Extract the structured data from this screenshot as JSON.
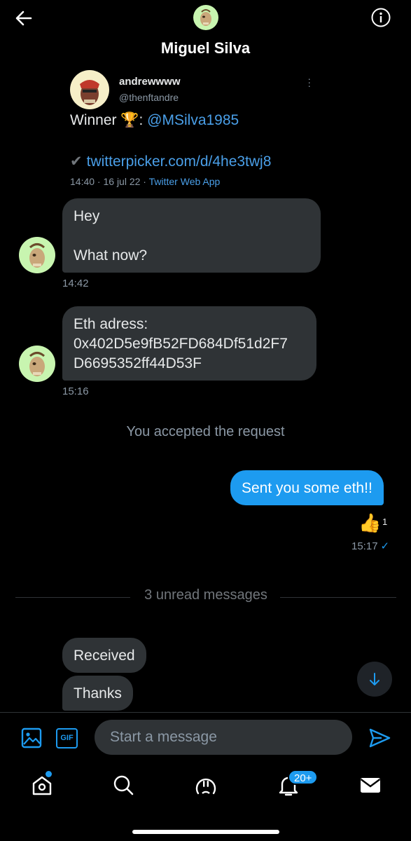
{
  "header": {
    "name": "Miguel Silva",
    "back_icon": "arrow-left-icon",
    "info_icon": "info-icon"
  },
  "tweet": {
    "display_name": "andrewwww",
    "handle": "@thenftandre",
    "text_prefix": "Winner 🏆: ",
    "mention": "@MSilva1985",
    "check": "✔",
    "link": "twitterpicker.com/d/4he3twj8",
    "meta_time": "14:40 · 16 jul 22 · ",
    "meta_source": "Twitter Web App"
  },
  "messages": {
    "m1_line1": "Hey",
    "m1_line2": "What now?",
    "m1_time": "14:42",
    "m2_line1": "Eth adress:",
    "m2_line2": "0x402D5e9fB52FD684Df51d2F7",
    "m2_line3": "D6695352ff44D53F",
    "m2_time": "15:16",
    "system_note": "You accepted the request",
    "sent_text": "Sent you some eth!!",
    "reaction_emoji": "👍",
    "reaction_count": "1",
    "sent_time": "15:17",
    "sent_status": "✓",
    "unread_label": "3 unread messages",
    "received_1": "Received",
    "received_2": "Thanks"
  },
  "composer": {
    "placeholder": "Start a message",
    "gif_label": "GIF"
  },
  "tabbar": {
    "notification_badge": "20+"
  },
  "colors": {
    "accent": "#1d9bf0",
    "bubble_in": "#2f3336",
    "background": "#000000"
  }
}
